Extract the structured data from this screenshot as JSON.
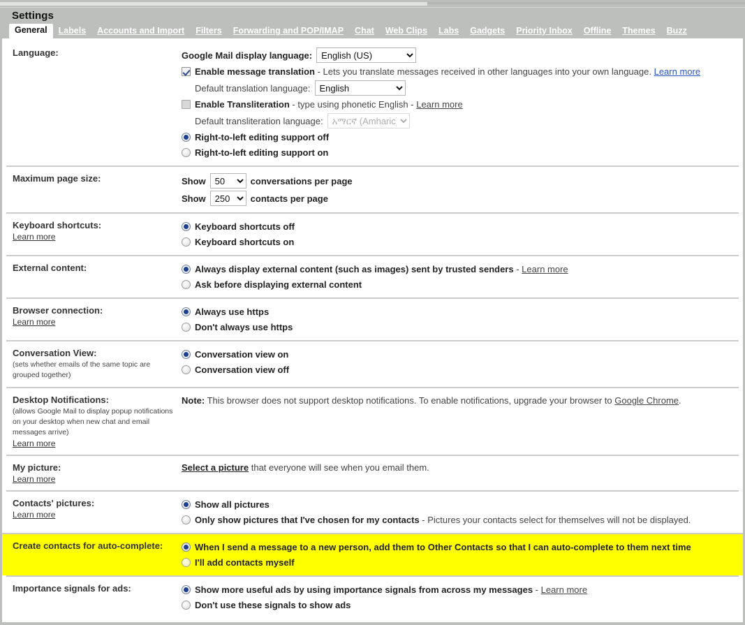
{
  "header": {
    "title": "Settings"
  },
  "tabs": [
    {
      "label": "General",
      "active": true
    },
    {
      "label": "Labels",
      "active": false
    },
    {
      "label": "Accounts and Import",
      "active": false
    },
    {
      "label": "Filters",
      "active": false
    },
    {
      "label": "Forwarding and POP/IMAP",
      "active": false
    },
    {
      "label": "Chat",
      "active": false
    },
    {
      "label": "Web Clips",
      "active": false
    },
    {
      "label": "Labs",
      "active": false
    },
    {
      "label": "Gadgets",
      "active": false
    },
    {
      "label": "Priority Inbox",
      "active": false
    },
    {
      "label": "Offline",
      "active": false
    },
    {
      "label": "Themes",
      "active": false
    },
    {
      "label": "Buzz",
      "active": false
    }
  ],
  "colors": {
    "highlight": "#ffff00",
    "chrome": "#bdbfbd",
    "link_blue": "#2a55c7",
    "divider": "#cccccc"
  },
  "sections": {
    "language": {
      "label": "Language:",
      "display_language_label": "Google Mail display language:",
      "display_language_value": "English (US)",
      "enable_translation_label": "Enable message translation",
      "enable_translation_desc": " - Lets you translate messages received in other languages into your own language. ",
      "enable_translation_link": "Learn more",
      "default_translation_label": "Default translation language:",
      "default_translation_value": "English",
      "enable_transliteration_label": "Enable Transliteration",
      "enable_transliteration_desc": " - type using phonetic English - ",
      "enable_transliteration_link": "Learn more",
      "default_transliteration_label": "Default transliteration language:",
      "default_transliteration_value": "አማርኛ (Amharic)",
      "rtl_off": "Right-to-left editing support off",
      "rtl_on": "Right-to-left editing support on"
    },
    "page_size": {
      "label": "Maximum page size:",
      "show_word": "Show",
      "conversations_value": "50",
      "conversations_suffix": "conversations per page",
      "contacts_value": "250",
      "contacts_suffix": "contacts per page"
    },
    "keyboard": {
      "label": "Keyboard shortcuts:",
      "learn_more": "Learn more",
      "off": "Keyboard shortcuts off",
      "on": "Keyboard shortcuts on"
    },
    "external_content": {
      "label": "External content:",
      "always": "Always display external content (such as images) sent by trusted senders",
      "always_sep": " - ",
      "always_link": "Learn more",
      "ask": "Ask before displaying external content"
    },
    "browser_connection": {
      "label": "Browser connection:",
      "learn_more": "Learn more",
      "https_always": "Always use https",
      "https_not_always": "Don't always use https"
    },
    "conversation_view": {
      "label": "Conversation View:",
      "sublabel": "(sets whether emails of the same topic are grouped together)",
      "on": "Conversation view on",
      "off": "Conversation view off"
    },
    "desktop_notifications": {
      "label": "Desktop Notifications:",
      "sublabel": "(allows Google Mail to display popup notifications on your desktop when new chat and email messages arrive)",
      "learn_more": "Learn more",
      "note_prefix": "Note:",
      "note_text": " This browser does not support desktop notifications. To enable notifications, upgrade your browser to ",
      "note_link": "Google Chrome",
      "note_suffix": "."
    },
    "my_picture": {
      "label": "My picture:",
      "learn_more": "Learn more",
      "select_link": "Select a picture",
      "select_suffix": " that everyone will see when you email them."
    },
    "contacts_pictures": {
      "label": "Contacts' pictures:",
      "learn_more": "Learn more",
      "show_all": "Show all pictures",
      "only_chosen": "Only show pictures that I've chosen for my contacts",
      "only_chosen_sep": " - ",
      "only_chosen_desc": "Pictures your contacts select for themselves will not be displayed."
    },
    "auto_complete": {
      "label": "Create contacts for auto-complete:",
      "option_auto": "When I send a message to a new person, add them to Other Contacts so that I can auto-complete to them next time",
      "option_manual": "I'll add contacts myself"
    },
    "importance_ads": {
      "label": "Importance signals for ads:",
      "show_more": "Show more useful ads by using importance signals from across my messages",
      "show_more_sep": " - ",
      "show_more_link": "Learn more",
      "dont_use": "Don't use these signals to show ads"
    }
  }
}
